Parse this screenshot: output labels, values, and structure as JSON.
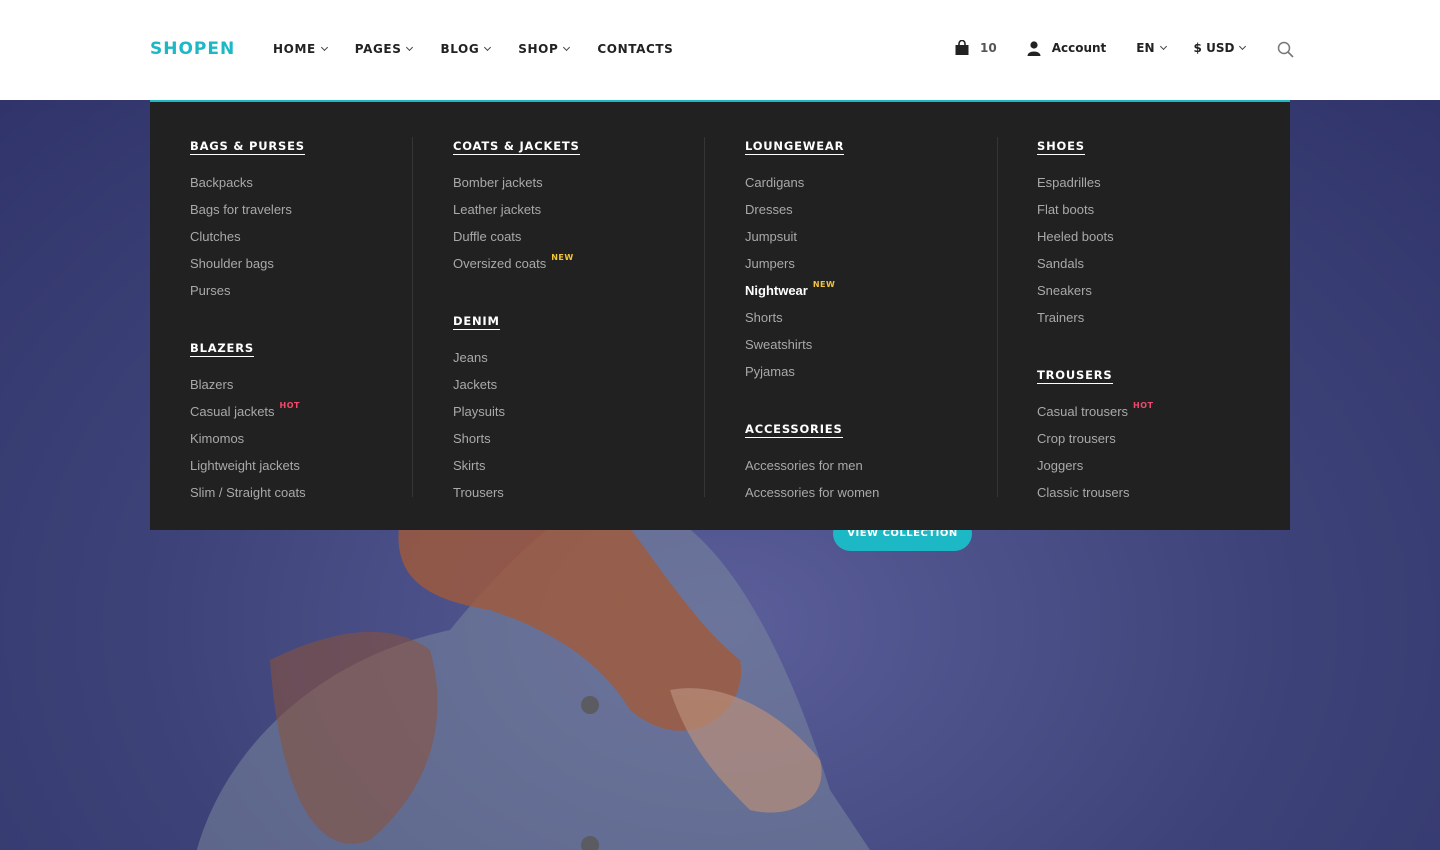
{
  "brand": {
    "logo": "SHOPEN",
    "accent": "#1cb8c6"
  },
  "nav": [
    {
      "label": "HOME",
      "has_dropdown": true
    },
    {
      "label": "PAGES",
      "has_dropdown": true
    },
    {
      "label": "BLOG",
      "has_dropdown": true
    },
    {
      "label": "SHOP",
      "has_dropdown": true
    },
    {
      "label": "CONTACTS",
      "has_dropdown": false
    }
  ],
  "tools": {
    "cart_icon": "shopping-bag-icon",
    "cart_count": "10",
    "account_icon": "user-icon",
    "account_label": "Account",
    "language": "EN",
    "currency": "$ USD",
    "search_icon": "search-icon"
  },
  "mega_menu": {
    "columns": [
      {
        "groups": [
          {
            "heading": "BAGS & PURSES",
            "items": [
              {
                "label": "Backpacks"
              },
              {
                "label": "Bags for travelers"
              },
              {
                "label": "Clutches"
              },
              {
                "label": "Shoulder bags"
              },
              {
                "label": "Purses"
              }
            ]
          },
          {
            "heading": "BLAZERS",
            "items": [
              {
                "label": "Blazers"
              },
              {
                "label": "Casual jackets",
                "badge": "HOT"
              },
              {
                "label": "Kimomos"
              },
              {
                "label": "Lightweight jackets"
              },
              {
                "label": "Slim / Straight coats"
              }
            ]
          }
        ]
      },
      {
        "groups": [
          {
            "heading": "COATS & JACKETS",
            "items": [
              {
                "label": "Bomber jackets"
              },
              {
                "label": "Leather jackets"
              },
              {
                "label": "Duffle coats"
              },
              {
                "label": "Oversized coats",
                "badge": "NEW"
              }
            ]
          },
          {
            "heading": "DENIM",
            "items": [
              {
                "label": "Jeans"
              },
              {
                "label": "Jackets"
              },
              {
                "label": "Playsuits"
              },
              {
                "label": "Shorts"
              },
              {
                "label": "Skirts"
              },
              {
                "label": "Trousers"
              }
            ]
          }
        ]
      },
      {
        "groups": [
          {
            "heading": "LOUNGEWEAR",
            "items": [
              {
                "label": "Cardigans"
              },
              {
                "label": "Dresses"
              },
              {
                "label": "Jumpsuit"
              },
              {
                "label": "Jumpers"
              },
              {
                "label": "Nightwear",
                "badge": "NEW",
                "active": true
              },
              {
                "label": "Shorts"
              },
              {
                "label": "Sweatshirts"
              },
              {
                "label": "Pyjamas"
              }
            ]
          },
          {
            "heading": "ACCESSORIES",
            "items": [
              {
                "label": "Accessories for men"
              },
              {
                "label": "Accessories for women"
              }
            ]
          }
        ]
      },
      {
        "groups": [
          {
            "heading": "SHOES",
            "items": [
              {
                "label": "Espadrilles"
              },
              {
                "label": "Flat boots"
              },
              {
                "label": "Heeled boots"
              },
              {
                "label": "Sandals"
              },
              {
                "label": "Sneakers"
              },
              {
                "label": "Trainers"
              }
            ]
          },
          {
            "heading": "TROUSERS",
            "items": [
              {
                "label": "Casual trousers",
                "badge": "HOT"
              },
              {
                "label": "Crop trousers"
              },
              {
                "label": "Joggers"
              },
              {
                "label": "Classic trousers"
              }
            ]
          }
        ]
      }
    ]
  },
  "hero": {
    "cta_label": "VIEW COLLECTION"
  },
  "colors": {
    "menu_bg": "#212121",
    "badge_new": "#f2c437",
    "badge_hot": "#f04a6a",
    "hero_bg": "#3d4378"
  }
}
